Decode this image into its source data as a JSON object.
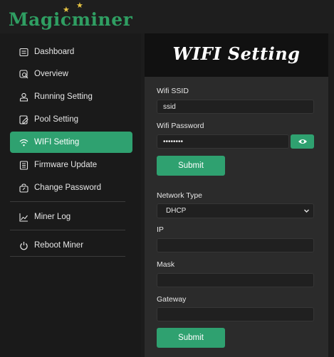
{
  "brand": {
    "name": "Magicminer"
  },
  "sidebar": {
    "items": [
      {
        "label": "Dashboard",
        "icon": "dashboard-icon"
      },
      {
        "label": "Overview",
        "icon": "overview-icon"
      },
      {
        "label": "Running Setting",
        "icon": "user-icon"
      },
      {
        "label": "Pool Setting",
        "icon": "pool-icon"
      },
      {
        "label": "WIFI Setting",
        "icon": "wifi-icon",
        "active": true
      },
      {
        "label": "Firmware Update",
        "icon": "firmware-icon"
      },
      {
        "label": "Change Password",
        "icon": "password-icon"
      },
      {
        "label": "Miner Log",
        "icon": "chart-line-icon"
      },
      {
        "label": "Reboot Miner",
        "icon": "power-icon"
      }
    ]
  },
  "main": {
    "title": "WIFI Setting",
    "wifi": {
      "ssid_label": "Wifi SSID",
      "ssid_value": "ssid",
      "password_label": "Wifi Password",
      "password_value": "••••••••",
      "submit_label": "Submit"
    },
    "network": {
      "type_label": "Network Type",
      "type_value": "DHCP",
      "ip_label": "IP",
      "ip_value": "",
      "mask_label": "Mask",
      "mask_value": "",
      "gateway_label": "Gateway",
      "gateway_value": "",
      "submit_label": "Submit"
    }
  },
  "colors": {
    "accent": "#2fa170",
    "brand": "#2f9e62",
    "star": "#e7c443",
    "background": "#1c1c1c"
  }
}
